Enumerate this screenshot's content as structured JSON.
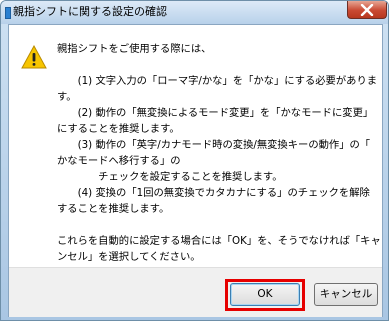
{
  "window": {
    "title": "親指シフトに関する設定の確認",
    "close_label": "×"
  },
  "dialog": {
    "icon": "warning-icon",
    "message_lines": [
      "親指シフトをご使用する際には、",
      "",
      "　　(1) 文字入力の「ローマ字/かな」を「かな」にする必要がありま",
      "す。",
      "　　(2) 動作の「無変換によるモード変更」を「かなモードに変更」",
      "にすることを推奨します。",
      "　　(3) 動作の「英字/カナモード時の変換/無変換キーの動作」の「",
      "かなモードへ移行する」の",
      "　　　　チェックを設定することを推奨します。",
      "　　(4) 変換の「1回の無変換でカタカナにする」のチェックを解除",
      "することを推奨します。",
      "",
      "これらを自動的に設定する場合には「OK」を、そうでなければ「キャ",
      "ンセル」を選択してください。"
    ]
  },
  "buttons": {
    "ok_label": "OK",
    "cancel_label": "キャンセル"
  },
  "colors": {
    "highlight": "#e60000",
    "titlebar": "#b8d1ea",
    "close": "#c94a33"
  }
}
